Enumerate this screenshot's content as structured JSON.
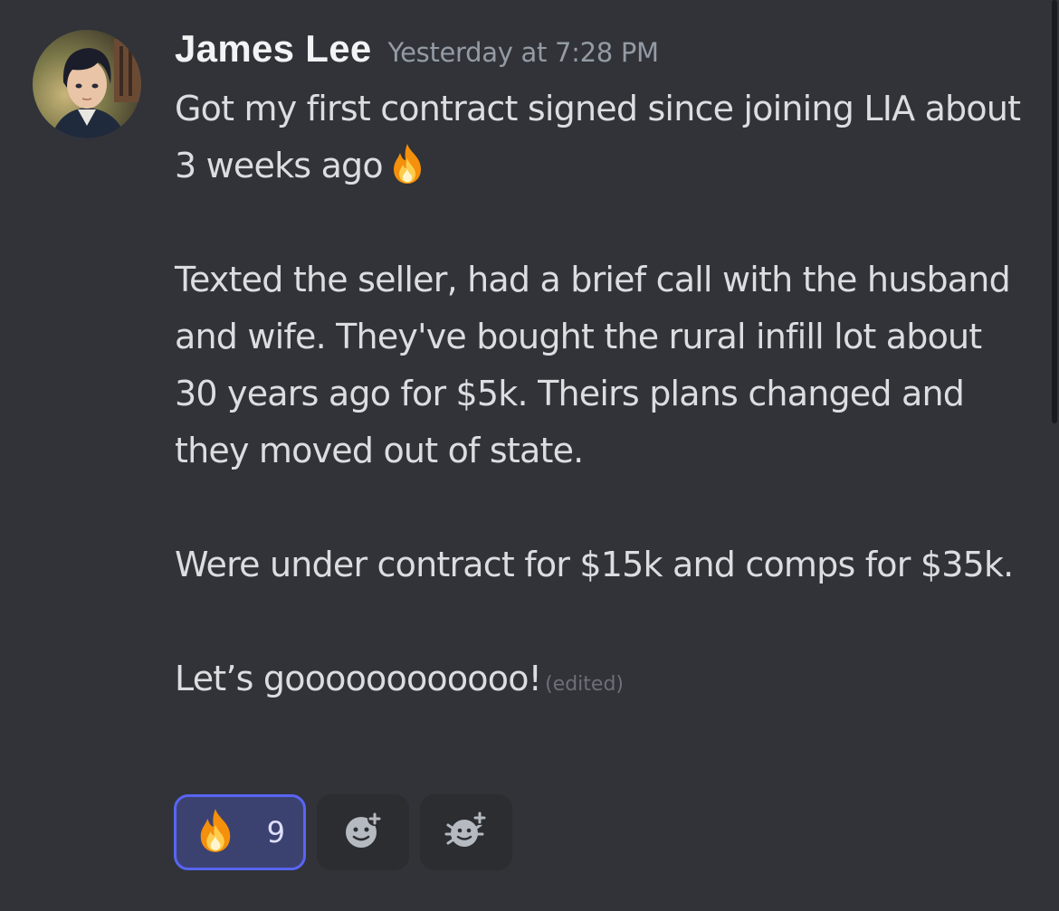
{
  "message": {
    "author": "James Lee",
    "timestamp": "Yesterday at 7:28 PM",
    "paragraphs": [
      "Got my first contract signed since joining LIA about 3 weeks ago",
      "Texted the seller, had a brief call with the husband and wife. They've bought the rural infill lot about 30 years ago for $5k. Theirs plans changed and they moved out of state.",
      "Were under contract for $15k and comps for $35k.",
      "Let’s goooooooooooo!"
    ],
    "edited_label": "(edited)",
    "avatar_icon": "user-avatar"
  },
  "reactions": {
    "fire": {
      "emoji": "🔥",
      "count": "9",
      "active": true
    },
    "add_reaction_icon": "add-reaction-icon",
    "add_super_reaction_icon": "add-super-reaction-icon"
  },
  "colors": {
    "background": "#313338",
    "username": "#f2f3f5",
    "text": "#dbdee1",
    "timestamp": "#949ba4",
    "reaction_active_bg": "#3c4270",
    "reaction_active_border": "#5865f2"
  }
}
